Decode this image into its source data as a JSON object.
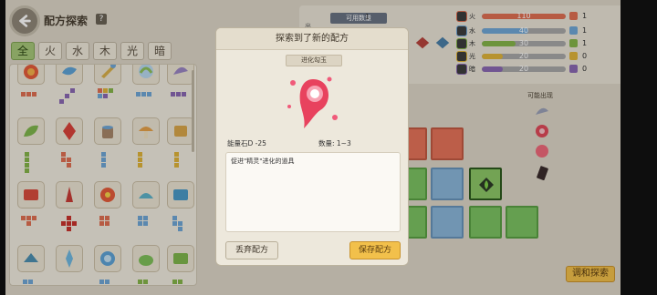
{
  "header": {
    "title": "配方探索",
    "help": "?"
  },
  "tabs": [
    {
      "label": "全",
      "active": true
    },
    {
      "label": "火",
      "active": false
    },
    {
      "label": "水",
      "active": false
    },
    {
      "label": "木",
      "active": false
    },
    {
      "label": "光",
      "active": false
    },
    {
      "label": "暗",
      "active": false
    }
  ],
  "stats": {
    "use_count_label": "可用数量",
    "use_count_value": "1",
    "side_char_1": "出",
    "side_char_2": "0",
    "rows": [
      {
        "label": "火",
        "value": "110",
        "count": "1",
        "fill": 1.0,
        "color": "#e07052",
        "badge": "#e07052"
      },
      {
        "label": "水",
        "value": "40",
        "count": "1",
        "fill": 0.55,
        "color": "#6fa7d6",
        "badge": "#6fa7d6"
      },
      {
        "label": "木",
        "value": "30",
        "count": "1",
        "fill": 0.4,
        "color": "#86b54a",
        "badge": "#86b54a"
      },
      {
        "label": "光",
        "value": "20",
        "count": "0",
        "fill": 0.25,
        "color": "#e0b43a",
        "badge": "#e0b43a"
      },
      {
        "label": "暗",
        "value": "20",
        "count": "0",
        "fill": 0.25,
        "color": "#8a68b2",
        "badge": "#8a68b2"
      }
    ]
  },
  "possible": {
    "label": "可能出现"
  },
  "explore_button": "调和探索",
  "modal": {
    "title": "探索到了新的配方",
    "tag": "进化勾玉",
    "energy": "能量石D  -25",
    "quantity": "数量:  1~3",
    "description": "促进\"精灵\"进化的道具",
    "discard": "丢弃配方",
    "save": "保存配方"
  },
  "colors": {
    "accent_yellow": "#f2c04b",
    "tab_active": "#a6c779",
    "background": "#ddd6c7"
  }
}
